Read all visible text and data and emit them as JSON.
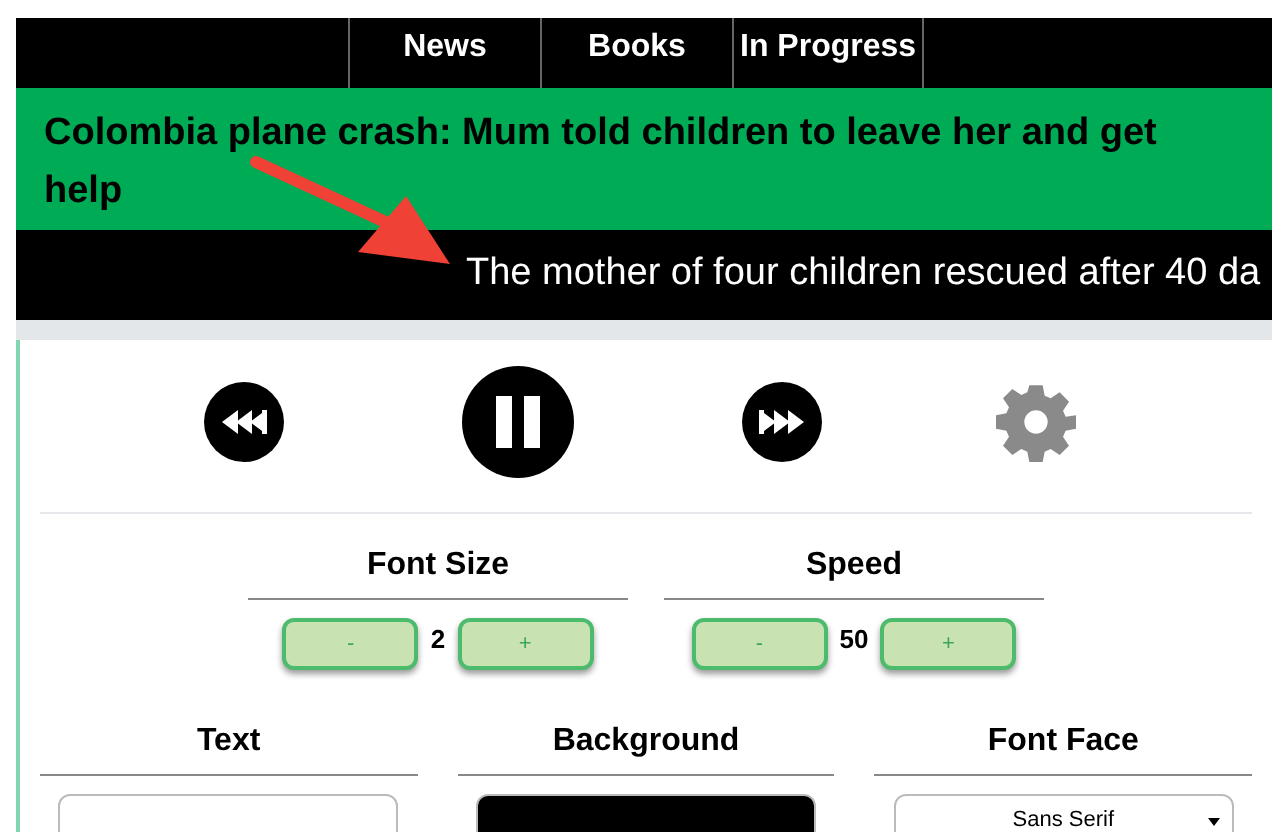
{
  "nav": {
    "tabs": [
      {
        "label": "News",
        "selected": false
      },
      {
        "label": "Books",
        "selected": false
      },
      {
        "label": "In Progress",
        "selected": false
      }
    ]
  },
  "headline": "Colombia plane crash: Mum told children to leave her and get help",
  "ticker": "The mother of four children rescued after 40 da",
  "player": {
    "playing": true
  },
  "steppers": [
    {
      "label": "Font Size",
      "decrement": "-",
      "value": "2",
      "increment": "+"
    },
    {
      "label": "Speed",
      "decrement": "-",
      "value": "50",
      "increment": "+"
    }
  ],
  "settings": [
    {
      "kind": "color",
      "label": "Text",
      "color": "#ffffff"
    },
    {
      "kind": "color",
      "label": "Background",
      "color": "#000000"
    },
    {
      "kind": "select",
      "label": "Font Face",
      "value": "Sans Serif"
    }
  ]
}
